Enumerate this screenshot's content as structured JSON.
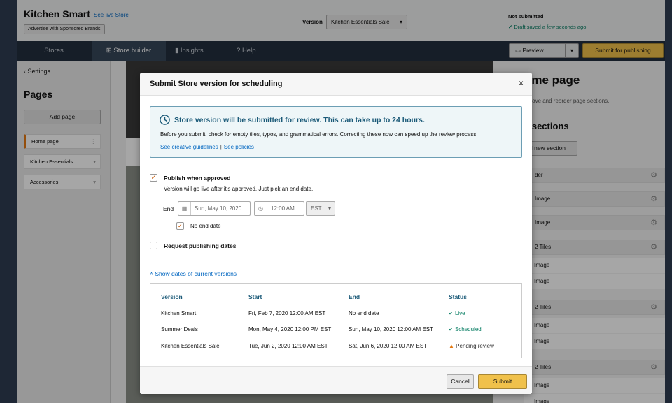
{
  "header": {
    "brand": "Kitchen Smart",
    "live_link": "See live Store",
    "advertise_label": "Advertise with Sponsored Brands",
    "version_label": "Version",
    "version_value": "Kitchen Essentials Sale",
    "status_title": "Not submitted",
    "draft_status": "Draft saved a few seconds ago"
  },
  "nav": {
    "stores": "Stores",
    "store_builder": "Store builder",
    "insights": "Insights",
    "help": "Help",
    "preview": "Preview",
    "submit_publishing": "Submit for publishing"
  },
  "sidebar": {
    "settings": "Settings",
    "pages_title": "Pages",
    "add_page": "Add page",
    "pages": [
      "Home page",
      "Kitchen Essentials",
      "Accessories"
    ]
  },
  "right_panel": {
    "title": "ome page",
    "subtitle": "emove and reorder page sections.",
    "sections_title": "e sections",
    "add_section": "d new section",
    "items": [
      "der",
      "Image",
      "Image",
      "2 Tiles",
      "2 Tiles",
      "2 Tiles"
    ],
    "sub_items": [
      "Image",
      "Image",
      "Image",
      "Image",
      "Image",
      "Image"
    ]
  },
  "modal": {
    "title": "Submit Store version for scheduling",
    "close": "×",
    "info_title": "Store version will be submitted for review. This can take up to 24 hours.",
    "info_body": "Before you submit, check for empty tiles, typos, and grammatical errors. Correcting these now can speed up the review process.",
    "link_guidelines": "See creative guidelines",
    "link_sep": "|",
    "link_policies": "See policies",
    "publish_label": "Publish when approved",
    "publish_desc": "Version will go live after it's approved. Just pick an end date.",
    "end_label": "End",
    "end_date": "Sun, May 10, 2020",
    "end_time": "12:00 AM",
    "timezone": "EST",
    "no_end_date": "No end date",
    "request_dates": "Request publishing dates",
    "show_dates": "Show dates of current versions",
    "table": {
      "headers": [
        "Version",
        "Start",
        "End",
        "Status"
      ],
      "rows": [
        [
          "Kitchen Smart",
          "Fri, Feb 7, 2020 12:00 AM EST",
          "No end date",
          "Live"
        ],
        [
          "Summer Deals",
          "Mon, May 4, 2020 12:00 PM EST",
          "Sun, May 10, 2020 12:00 AM EST",
          "Scheduled"
        ],
        [
          "Kitchen Essentials Sale",
          "Tue, Jun 2, 2020 12:00 AM EST",
          "Sat, Jun 6, 2020 12:00 AM EST",
          "Pending review"
        ]
      ]
    },
    "cancel": "Cancel",
    "submit": "Submit"
  },
  "colors": {
    "accent": "#f0c14b",
    "nav_bg": "#232f3e",
    "link": "#0066c0",
    "success": "#067d62",
    "warning": "#e47911"
  }
}
